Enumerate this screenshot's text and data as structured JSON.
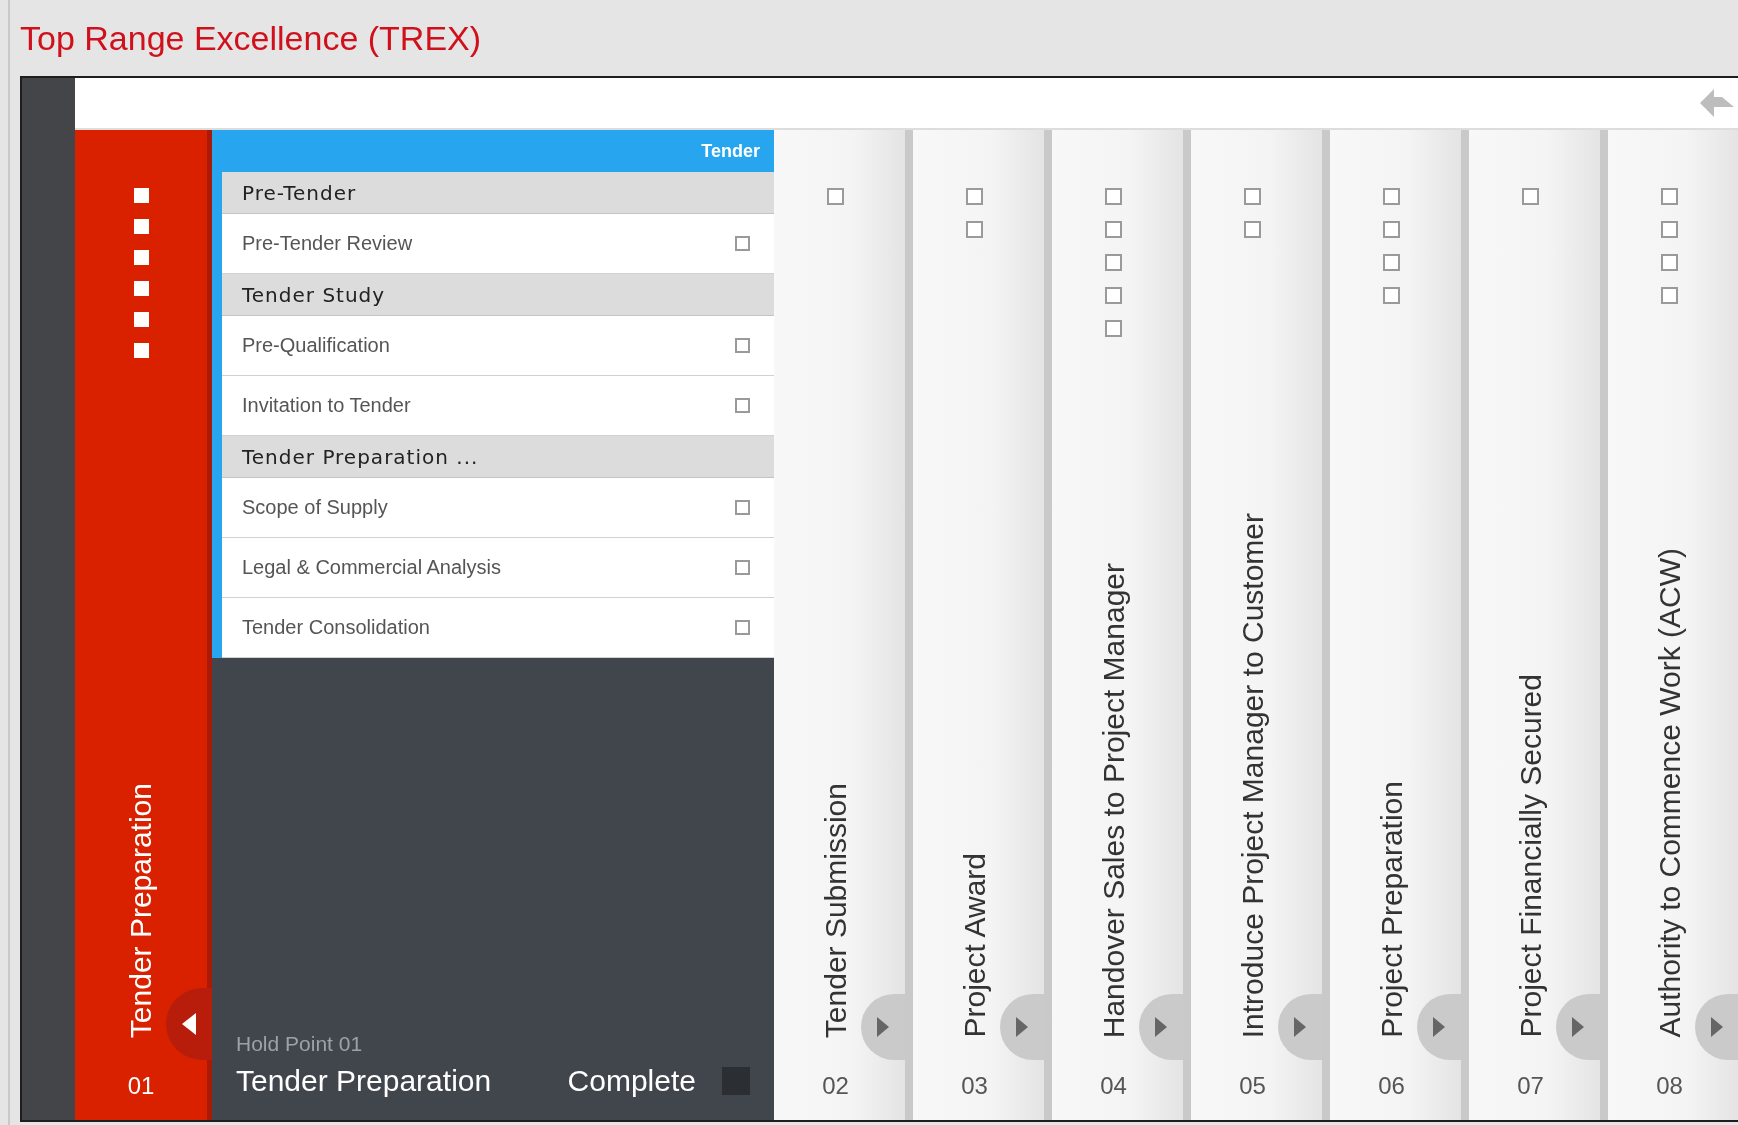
{
  "window": {
    "title": "Top Range Excellence (TREX)"
  },
  "current_stage": {
    "number": "01",
    "title": "Tender Preparation",
    "markers": [
      {
        "checked": false
      },
      {
        "checked": false
      },
      {
        "checked": false
      },
      {
        "checked": false
      },
      {
        "checked": false
      },
      {
        "checked": false
      }
    ],
    "panel": {
      "header": "Tender",
      "groups": [
        {
          "title": "Pre-Tender",
          "items": [
            {
              "label": "Pre-Tender Review",
              "checked": false
            }
          ]
        },
        {
          "title": "Tender Study",
          "items": [
            {
              "label": "Pre-Qualification",
              "checked": false
            },
            {
              "label": "Invitation to Tender",
              "checked": false
            }
          ]
        },
        {
          "title": "Tender Preparation ...",
          "items": [
            {
              "label": "Scope of Supply",
              "checked": false
            },
            {
              "label": "Legal & Commercial Analysis",
              "checked": false
            },
            {
              "label": "Tender Consolidation",
              "checked": false
            }
          ]
        }
      ]
    },
    "hold_point": {
      "label": "Hold Point 01",
      "title": "Tender Preparation",
      "status": "Complete",
      "checked": false
    }
  },
  "stages": [
    {
      "number": "02",
      "title": "Tender Submission",
      "tasks": [
        {
          "checked": false
        }
      ]
    },
    {
      "number": "03",
      "title": "Project Award",
      "tasks": [
        {
          "checked": false
        },
        {
          "checked": false
        }
      ]
    },
    {
      "number": "04",
      "title": "Handover Sales to Project Manager",
      "tasks": [
        {
          "checked": false
        },
        {
          "checked": false
        },
        {
          "checked": false
        },
        {
          "checked": false
        },
        {
          "checked": false
        }
      ]
    },
    {
      "number": "05",
      "title": "Introduce Project Manager to Customer",
      "tasks": [
        {
          "checked": false
        },
        {
          "checked": false
        }
      ]
    },
    {
      "number": "06",
      "title": "Project Preparation",
      "tasks": [
        {
          "checked": false
        },
        {
          "checked": false
        },
        {
          "checked": false
        },
        {
          "checked": false
        }
      ]
    },
    {
      "number": "07",
      "title": "Project Financially Secured",
      "tasks": [
        {
          "checked": false
        }
      ]
    },
    {
      "number": "08",
      "title": "Authority to Commence Work (ACW)",
      "tasks": [
        {
          "checked": false
        },
        {
          "checked": false
        },
        {
          "checked": false
        },
        {
          "checked": false
        }
      ]
    }
  ]
}
